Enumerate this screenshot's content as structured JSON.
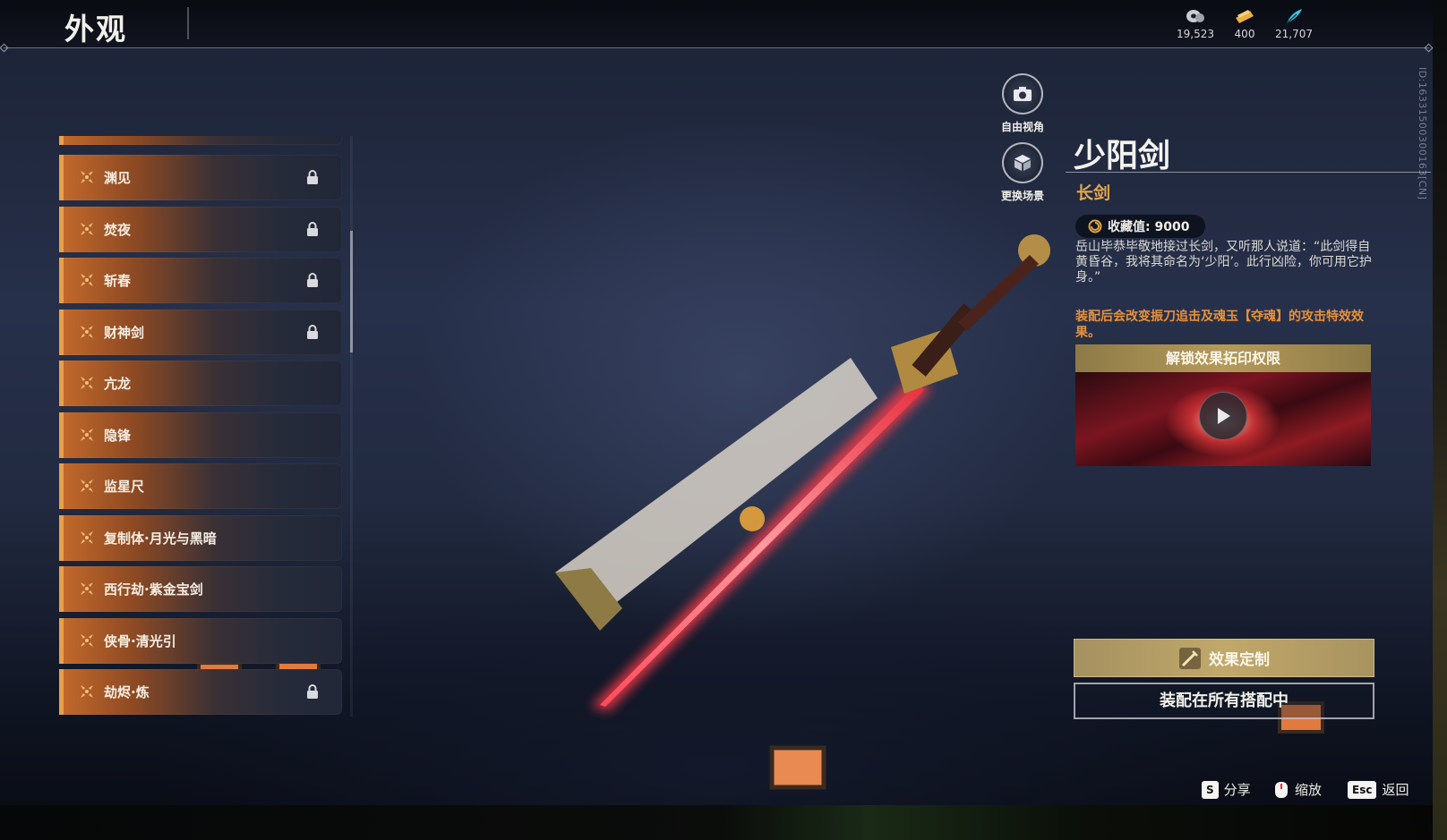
{
  "header": {
    "title": "外观"
  },
  "currencies": [
    {
      "icon": "jade-coin-icon",
      "value": "19,523"
    },
    {
      "icon": "gold-ticket-icon",
      "value": "400"
    },
    {
      "icon": "blue-feather-icon",
      "value": "21,707"
    }
  ],
  "version_id": "ID:16331500300163[CN]",
  "skin_list": {
    "items": [
      {
        "label": "渊见",
        "locked": true
      },
      {
        "label": "焚夜",
        "locked": true
      },
      {
        "label": "斩春",
        "locked": true
      },
      {
        "label": "财神剑",
        "locked": true
      },
      {
        "label": "亢龙",
        "locked": false
      },
      {
        "label": "隐锋",
        "locked": false
      },
      {
        "label": "监星尺",
        "locked": false
      },
      {
        "label": "复制体·月光与黑暗",
        "locked": false
      },
      {
        "label": "西行劫·紫金宝剑",
        "locked": false
      },
      {
        "label": "侠骨·清光引",
        "locked": false
      },
      {
        "label": "劫烬·炼",
        "locked": true
      }
    ]
  },
  "view_controls": {
    "free_camera": "自由视角",
    "change_scene": "更换场景"
  },
  "detail": {
    "name": "少阳剑",
    "type": "长剑",
    "collection": "收藏值: 9000",
    "lore": "岳山毕恭毕敬地接过长剑，又听那人说道：“此剑得自黄昏谷，我将其命名为‘少阳’。此行凶险，你可用它护身。”",
    "effect_note": "装配后会改变振刀追击及魂玉【夺魂】的攻击特效效果。",
    "unlock_title": "解锁效果拓印权限",
    "customize_label": "效果定制",
    "equip_label": "装配在所有搭配中"
  },
  "hints": {
    "share_key": "S",
    "share_label": "分享",
    "zoom_label": "缩放",
    "back_key": "Esc",
    "back_label": "返回"
  },
  "colors": {
    "accent_gold": "#e3a94c",
    "effect_orange": "#e7913a",
    "list_edge": "#e8a04a"
  }
}
